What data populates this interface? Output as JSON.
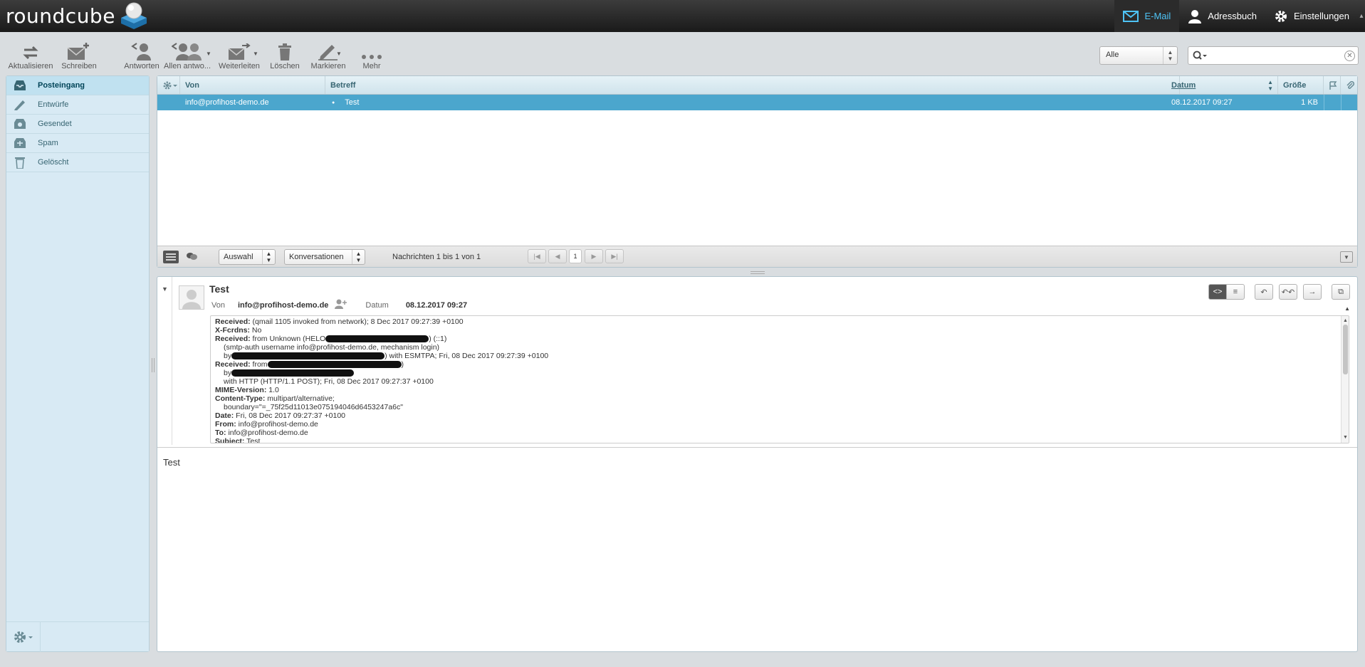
{
  "app": {
    "logo": "roundcube"
  },
  "topnav": {
    "mail": "E-Mail",
    "addressbook": "Adressbuch",
    "settings": "Einstellungen"
  },
  "toolbar": {
    "refresh": "Aktualisieren",
    "compose": "Schreiben",
    "reply": "Antworten",
    "reply_all": "Allen antwo...",
    "forward": "Weiterleiten",
    "delete": "Löschen",
    "mark": "Markieren",
    "more": "Mehr"
  },
  "filter": {
    "selected": "Alle"
  },
  "search": {
    "placeholder": ""
  },
  "folders": [
    {
      "label": "Posteingang",
      "icon": "inbox-icon",
      "selected": true
    },
    {
      "label": "Entwürfe",
      "icon": "drafts-icon"
    },
    {
      "label": "Gesendet",
      "icon": "sent-icon"
    },
    {
      "label": "Spam",
      "icon": "spam-icon"
    },
    {
      "label": "Gelöscht",
      "icon": "trash-icon"
    }
  ],
  "list": {
    "columns": {
      "from": "Von",
      "subject": "Betreff",
      "date": "Datum",
      "size": "Größe"
    },
    "rows": [
      {
        "from": "info@profihost-demo.de",
        "subject": "Test",
        "date": "08.12.2017 09:27",
        "size": "1 KB"
      }
    ],
    "footer": {
      "selection": "Auswahl",
      "threads": "Konversationen",
      "count": "Nachrichten 1 bis 1 von 1",
      "page": "1"
    }
  },
  "preview": {
    "subject": "Test",
    "from_label": "Von",
    "from": "info@profihost-demo.de",
    "date_label": "Datum",
    "date": "08.12.2017 09:27",
    "headers": [
      {
        "key": "Received:",
        "value": " (qmail 1105 invoked from network); 8 Dec 2017 09:27:39 +0100"
      },
      {
        "key": "X-Fcrdns:",
        "value": " No"
      },
      {
        "key": "Received:",
        "value": " from Unknown (HELO",
        "value2": ") (::1)"
      },
      {
        "indent": "(smtp-auth username info@profihost-demo.de, mechanism login)"
      },
      {
        "indent_pre": "by",
        "indent_post": ") with ESMTPA; Fri, 08 Dec 2017 09:27:39 +0100"
      },
      {
        "key": "Received:",
        "value": " from",
        "value2": ")"
      },
      {
        "indent_pre": "by"
      },
      {
        "indent": "with HTTP (HTTP/1.1 POST); Fri, 08 Dec 2017 09:27:37 +0100"
      },
      {
        "key": "MIME-Version:",
        "value": " 1.0"
      },
      {
        "key": "Content-Type:",
        "value": " multipart/alternative;"
      },
      {
        "indent": "boundary=\"=_75f25d11013e075194046d6453247a6c\""
      },
      {
        "key": "Date:",
        "value": " Fri, 08 Dec 2017 09:27:37 +0100"
      },
      {
        "key": "From:",
        "value": " info@profihost-demo.de"
      },
      {
        "key": "To:",
        "value": " info@profihost-demo.de"
      },
      {
        "key": "Subject:",
        "value": " Test"
      }
    ],
    "body": "Test"
  },
  "colors": {
    "accent": "#4ba6cd",
    "topbar": "#1a1a1a",
    "active_nav": "#4ec3f5"
  }
}
